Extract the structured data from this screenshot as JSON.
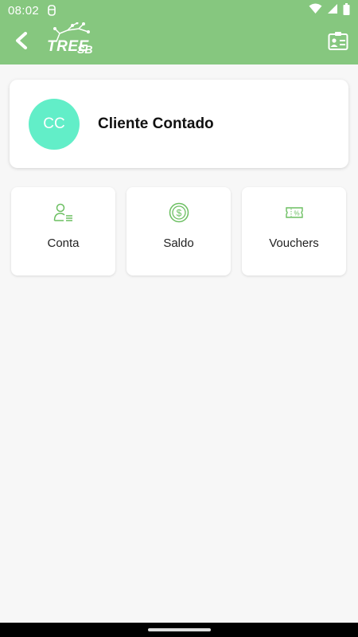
{
  "status_bar": {
    "time": "08:02",
    "icons": [
      "notification-icon",
      "wifi-icon",
      "signal-icon",
      "battery-icon"
    ]
  },
  "app_bar": {
    "logo_text": "TREE",
    "logo_sub": "SB",
    "icons": [
      "back-arrow-icon",
      "contact-card-icon"
    ]
  },
  "profile": {
    "initials": "CC",
    "name": "Cliente Contado",
    "avatar_color": "#62eec8"
  },
  "tiles": [
    {
      "label": "Conta",
      "icon": "user-list-icon"
    },
    {
      "label": "Saldo",
      "icon": "coin-dollar-icon"
    },
    {
      "label": "Vouchers",
      "icon": "voucher-icon"
    }
  ],
  "colors": {
    "primary": "#86c77f",
    "icon_green": "#6bbf61",
    "background": "#f7f7f7"
  }
}
